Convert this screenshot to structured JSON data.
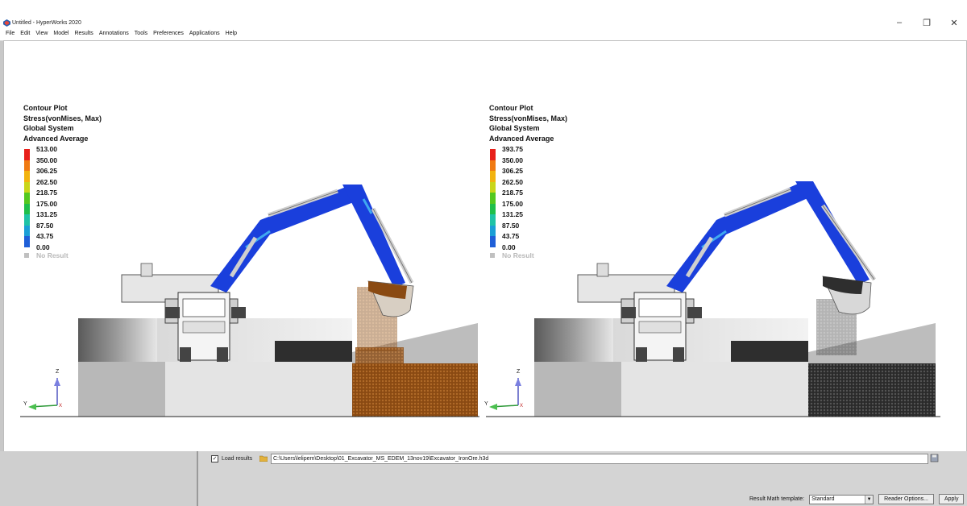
{
  "window": {
    "title": "Untitled - HyperWorks 2020",
    "controls": [
      "–",
      "❐",
      "✕"
    ]
  },
  "menu": [
    "File",
    "Edit",
    "View",
    "Model",
    "Results",
    "Annotations",
    "Tools",
    "Preferences",
    "Applications",
    "Help"
  ],
  "left_panel": {
    "legend": {
      "lines": [
        "Contour Plot",
        "Stress(vonMises, Max)",
        "Global System",
        "Advanced Average"
      ],
      "values": [
        "513.00",
        "350.00",
        "306.25",
        "262.50",
        "218.75",
        "175.00",
        "131.25",
        "87.50",
        "43.75",
        "0.00"
      ],
      "no_result": "No Result"
    },
    "pile_color": "#8a4a12"
  },
  "right_panel": {
    "legend": {
      "lines": [
        "Contour Plot",
        "Stress(vonMises, Max)",
        "Global System",
        "Advanced Average"
      ],
      "values": [
        "393.75",
        "350.00",
        "306.25",
        "262.50",
        "218.75",
        "175.00",
        "131.25",
        "87.50",
        "43.75",
        "0.00"
      ],
      "no_result": "No Result"
    },
    "pile_color": "#2e2e2e"
  },
  "legend_colors": [
    "#e8201a",
    "#f07a12",
    "#f2b30f",
    "#c9d61a",
    "#54c81f",
    "#1fbf4a",
    "#1fc3a6",
    "#1b9fd6",
    "#1f5fd8",
    "#1a2fa8"
  ],
  "axes": {
    "z": "Z",
    "y": "Y",
    "x": "X"
  },
  "bottom": {
    "load_results_label": "Load results",
    "path": "C:\\Users\\lelipem\\Desktop\\01_Excavator_MS_EDEM_13nov19\\Excavator_IronOre.h3d",
    "template_label": "Result Math template:",
    "template_value": "Standard",
    "reader_options": "Reader Options...",
    "apply": "Apply"
  }
}
